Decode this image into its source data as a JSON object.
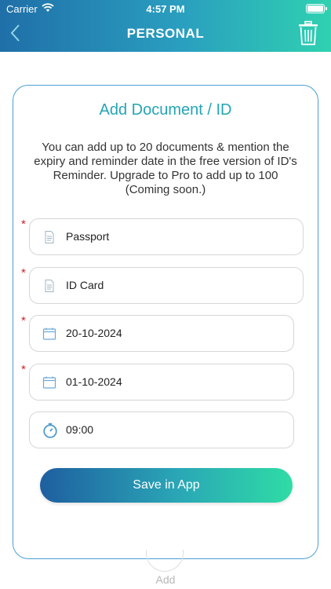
{
  "status": {
    "carrier": "Carrier",
    "time": "4:57 PM"
  },
  "header": {
    "title": "PERSONAL"
  },
  "card": {
    "title": "Add Document / ID",
    "description": "You can add up to 20 documents & mention the expiry and reminder date in the free version of ID's Reminder. Upgrade to Pro to add up to 100 (Coming soon.)"
  },
  "fields": {
    "doc_type": "Passport",
    "doc_name": "ID Card",
    "expiry_date": "20-10-2024",
    "reminder_date": "01-10-2024",
    "reminder_time": "09:00",
    "required_mark": "*"
  },
  "actions": {
    "save_label": "Save in App",
    "add_label": "Add"
  },
  "colors": {
    "accent": "#24a5b5",
    "required": "#d0202a",
    "card_border": "#4a9fd6"
  }
}
